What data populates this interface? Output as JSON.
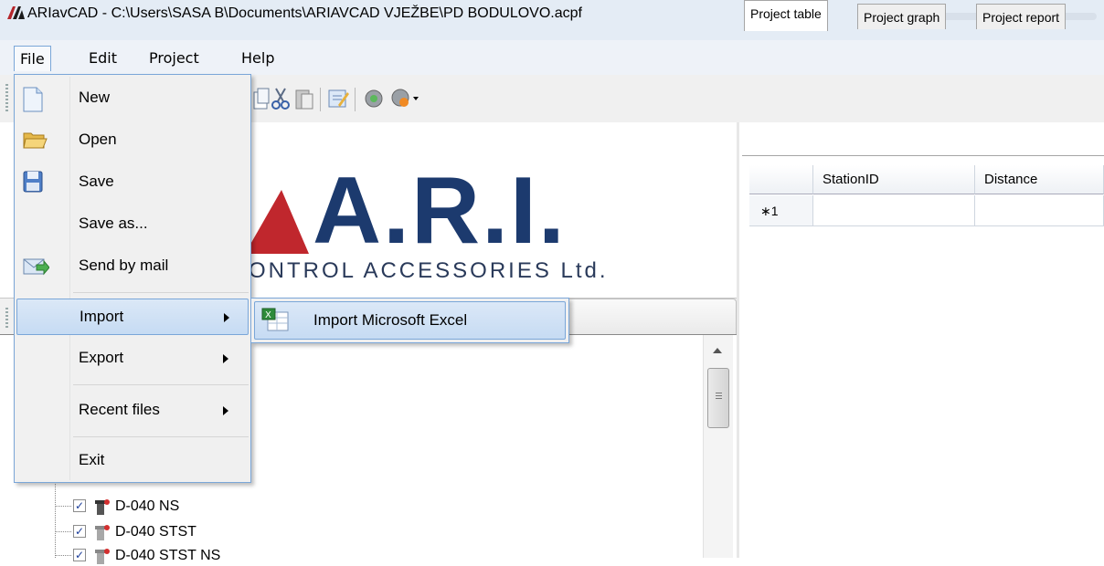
{
  "window": {
    "title": "ARIavCAD - C:\\Users\\SASA B\\Documents\\ARIAVCAD VJEŽBE\\PD BODULOVO.acpf"
  },
  "menubar": {
    "items": [
      {
        "label": "File"
      },
      {
        "label": "Edit"
      },
      {
        "label": "Project"
      },
      {
        "label": "Help"
      }
    ]
  },
  "file_menu": {
    "items": [
      {
        "label": "New",
        "icon": "new-document-icon"
      },
      {
        "label": "Open",
        "icon": "open-folder-icon"
      },
      {
        "label": "Save",
        "icon": "floppy-disk-icon"
      },
      {
        "label": "Save as..."
      },
      {
        "label": "Send by mail",
        "icon": "mail-icon"
      },
      {
        "label": "Import"
      },
      {
        "label": "Export"
      },
      {
        "label": "Recent files"
      },
      {
        "label": "Exit"
      }
    ]
  },
  "import_submenu": {
    "items": [
      {
        "label": "Import Microsoft Excel",
        "icon": "excel-icon"
      }
    ]
  },
  "logo": {
    "main": "A.R.I.",
    "sub": "ONTROL ACCESSORIES Ltd."
  },
  "tree": {
    "items": [
      {
        "label": "D-040 NS",
        "checked": true
      },
      {
        "label": "D-040 STST",
        "checked": true
      },
      {
        "label": "D-040 STST NS",
        "checked": true
      }
    ]
  },
  "right_panel": {
    "tabs": [
      {
        "label": "Project table"
      },
      {
        "label": "Project graph"
      },
      {
        "label": "Project report"
      }
    ],
    "grid": {
      "columns": [
        "StationID",
        "Distance"
      ],
      "rows": [
        {
          "marker": "∗1",
          "StationID": "",
          "Distance": ""
        }
      ]
    }
  },
  "colors": {
    "menu_highlight": "#c6dbf3",
    "menu_border": "#7aa6d8",
    "logo_blue": "#1c3a6e",
    "logo_red": "#c0272d"
  }
}
